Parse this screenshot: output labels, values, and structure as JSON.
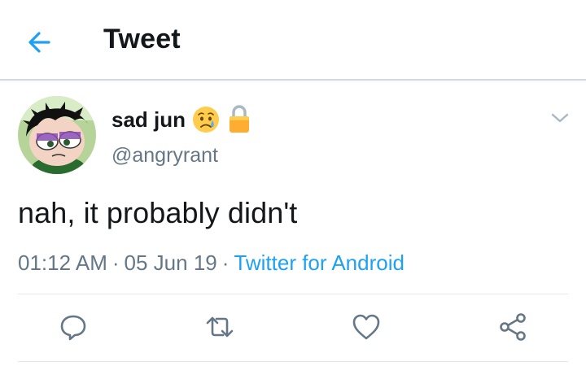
{
  "header": {
    "back_icon": "arrow-left-icon",
    "title": "Tweet"
  },
  "tweet": {
    "display_name": "sad jun",
    "name_emoji": "sad-relieved-face-emoji",
    "protected_icon": "lock-icon",
    "handle": "@angryrant",
    "menu_icon": "chevron-down-icon",
    "text": "nah, it probably didn't",
    "time": "01:12 AM",
    "date": "05 Jun 19",
    "separator": "·",
    "source": "Twitter for Android"
  },
  "actions": [
    {
      "icon": "reply-icon"
    },
    {
      "icon": "retweet-icon"
    },
    {
      "icon": "like-icon"
    },
    {
      "icon": "share-icon"
    }
  ],
  "colors": {
    "accent": "#1da1f2",
    "text": "#14171a",
    "secondary": "#657786",
    "border": "#d3d9de",
    "icon": "#657786"
  }
}
